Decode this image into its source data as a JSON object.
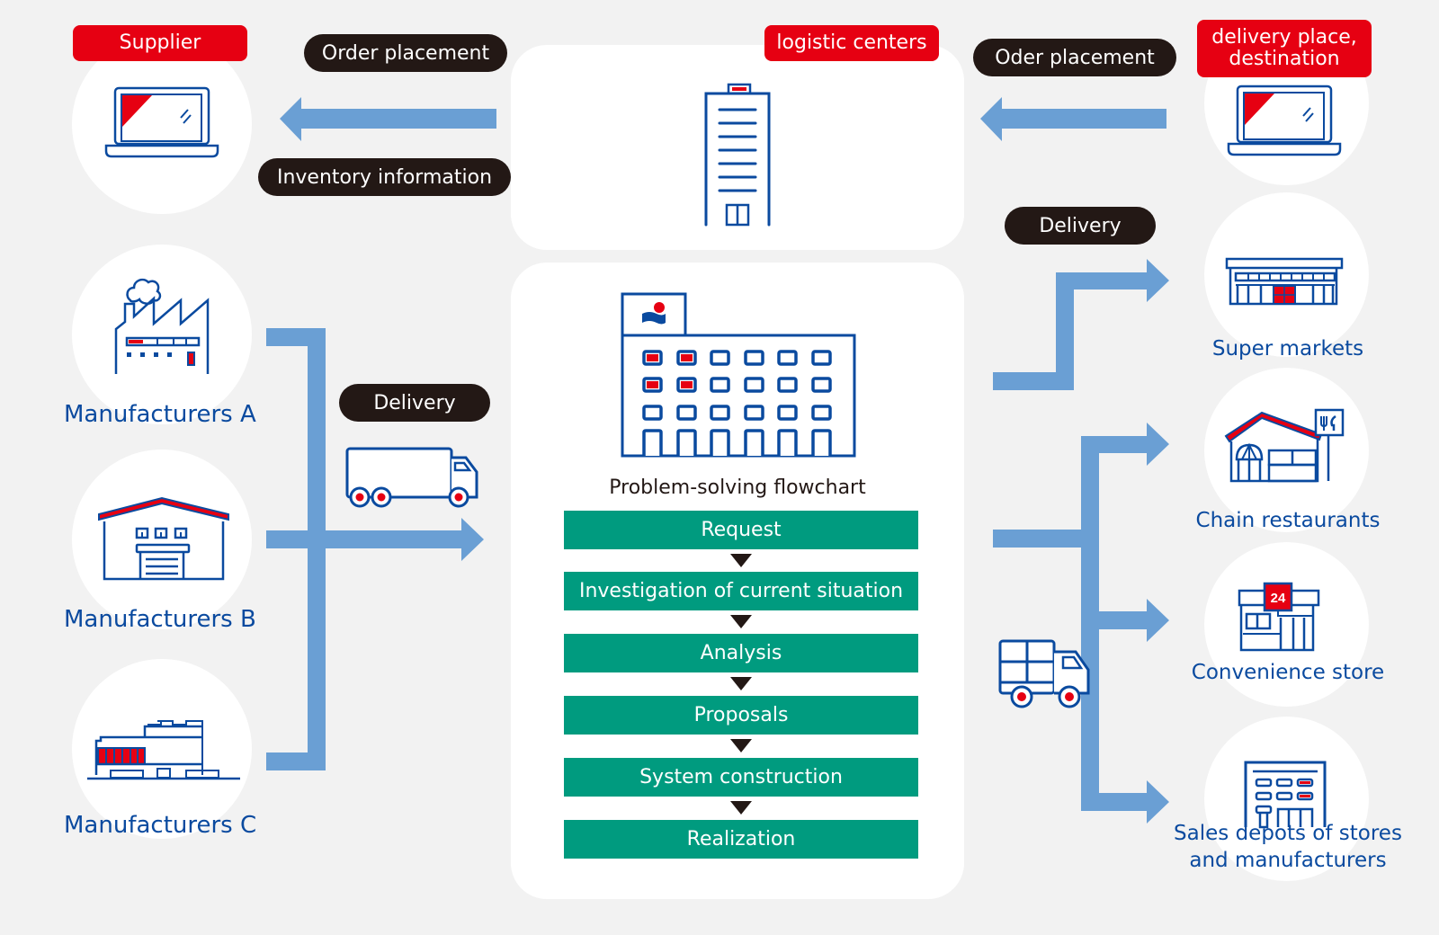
{
  "colors": {
    "background": "#f2f2f2",
    "accent_red": "#e60012",
    "icon_blue": "#0a4a9f",
    "arrow_blue": "#6a9fd4",
    "step_green": "#009b7f",
    "pill_dark": "#231815"
  },
  "supplier": {
    "tag": "Supplier",
    "icon": "laptop-icon"
  },
  "flows_top_left": {
    "order_label": "Order placement",
    "inventory_label": "Inventory information"
  },
  "logistic_center": {
    "tag": "logistic centers",
    "icon": "office-tower-icon"
  },
  "flows_top_right": {
    "order_label": "Oder placement"
  },
  "destination": {
    "tag": "delivery place, destination",
    "icon": "laptop-icon"
  },
  "manufacturers": [
    {
      "label": "Manufacturers A",
      "icon": "factory-icon"
    },
    {
      "label": "Manufacturers B",
      "icon": "warehouse-icon"
    },
    {
      "label": "Manufacturers C",
      "icon": "plant-building-icon"
    }
  ],
  "inbound_delivery": {
    "label": "Delivery",
    "icon": "truck-icon"
  },
  "center": {
    "icon": "company-building-icon",
    "flowchart_title": "Problem-solving flowchart",
    "steps": [
      "Request",
      "Investigation of current situation",
      "Analysis",
      "Proposals",
      "System construction",
      "Realization"
    ]
  },
  "outbound_delivery": {
    "label": "Delivery",
    "icon": "box-truck-icon"
  },
  "destinations": [
    {
      "label": "Super markets",
      "icon": "supermarket-icon"
    },
    {
      "label": "Chain restaurants",
      "icon": "restaurant-icon"
    },
    {
      "label": "Convenience store",
      "icon": "convenience-store-icon",
      "badge": "24"
    },
    {
      "label": "Sales depots of stores and manufacturers",
      "line1": "Sales depots of stores",
      "line2": "and manufacturers",
      "icon": "sales-depot-icon"
    }
  ]
}
